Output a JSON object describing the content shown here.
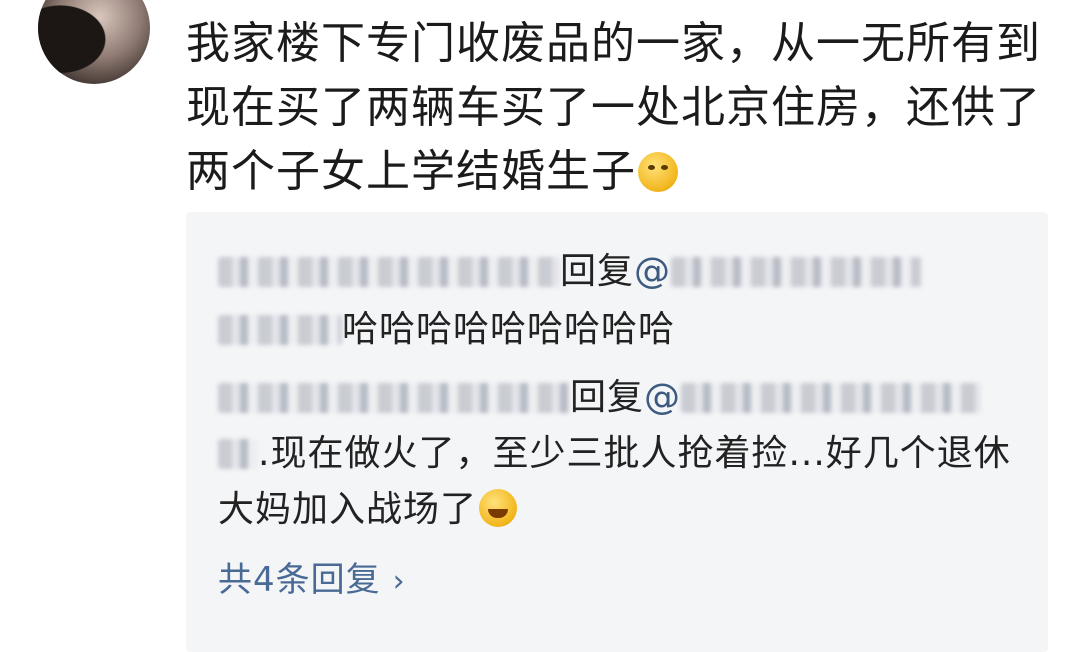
{
  "comment": {
    "text": "我家楼下专门收废品的一家，从一无所有到现在买了两辆车买了一处北京住房，还供了两个子女上学结婚生子",
    "emoji": "shy-smile-emoji"
  },
  "replies": [
    {
      "action": "回复",
      "at_prefix": "@",
      "text": "哈哈哈哈哈哈哈哈哈"
    },
    {
      "action": "回复",
      "at_prefix": "@",
      "text": ".现在做火了，至少三批人抢着捡...好几个退休大妈加入战场了",
      "emoji": "laugh-cry-emoji"
    }
  ],
  "more_replies": {
    "label": "共4条回复",
    "chevron": "chevron-right-icon"
  }
}
